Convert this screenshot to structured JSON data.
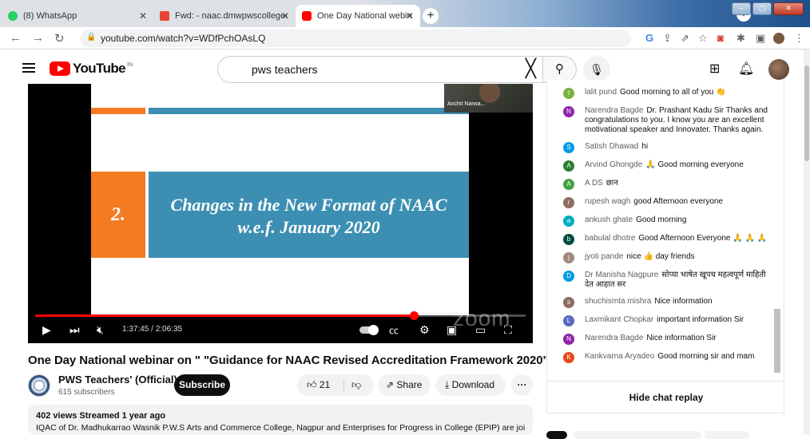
{
  "browser": {
    "tabs": [
      {
        "label": "(8) WhatsApp",
        "color": "#25d366"
      },
      {
        "label": "Fwd: - naac.dmwpwscollege@gm",
        "color": "#ea4335"
      },
      {
        "label": "One Day National webinar on \" \"",
        "color": "#ff0000"
      }
    ],
    "url": "youtube.com/watch?v=WDfPchOAsLQ"
  },
  "youtube": {
    "logo": "YouTube",
    "country": "IN",
    "search_query": "pws teachers"
  },
  "video": {
    "slide_number": "2.",
    "slide_line1": "Changes in the New Format of NAAC",
    "slide_line2": "w.e.f. January 2020",
    "participant_name": "Anchit Narwa...",
    "watermark": "zoom",
    "time": "1:37:45 / 2:06:35",
    "progress_fraction": 0.772
  },
  "meta": {
    "title": "One Day National webinar on \" \"Guidance for NAAC Revised Accreditation Framework 2020\"",
    "channel": "PWS Teachers' (Official)",
    "subscribers": "615 subscribers",
    "subscribe_label": "Subscribe",
    "likes": "21",
    "share_label": "Share",
    "download_label": "Download",
    "views": "402 views  Streamed 1 year ago",
    "description": "IQAC of Dr. Madhukarrao Wasnik P.W.S Arts and Commerce College, Nagpur and Enterprises for Progress in College (EPIP) are jointly"
  },
  "chat": {
    "messages": [
      {
        "initial": "l",
        "color": "#7cb342",
        "author": "lalit pund",
        "text": "Good morning to all of you 👏"
      },
      {
        "initial": "N",
        "color": "#8e24aa",
        "author": "Narendra Bagde",
        "text": "Dr. Prashant Kadu Sir Thanks and congratulations to you. I know you are an excellent motivational speaker and Innovater. Thanks again."
      },
      {
        "initial": "S",
        "color": "#039be5",
        "author": "Satish Dhawad",
        "text": "hi"
      },
      {
        "initial": "A",
        "color": "#2e7d32",
        "author": "Arvind Ghongde",
        "text": "🙏 Good morning everyone"
      },
      {
        "initial": "A",
        "color": "#43a047",
        "author": "A DS",
        "text": "छान"
      },
      {
        "initial": "r",
        "color": "#8d6e63",
        "author": "rupesh wagh",
        "text": "good Afternoon everyone"
      },
      {
        "initial": "a",
        "color": "#00acc1",
        "author": "ankush ghate",
        "text": "Good morning"
      },
      {
        "initial": "b",
        "color": "#004d40",
        "author": "babulal dhotre",
        "text": "Good Afternoon Everyone 🙏 🙏 🙏"
      },
      {
        "initial": "j",
        "color": "#a1887f",
        "author": "jyoti pande",
        "text": "nice 👍 day friends"
      },
      {
        "initial": "D",
        "color": "#039be5",
        "author": "Dr Manisha Nagpure",
        "text": "सोप्या भाषेत खूपच महत्वपूर्ण माहिती देत आहात सर"
      },
      {
        "initial": "s",
        "color": "#8d6e63",
        "author": "shuchismta mishra",
        "text": "Nice information"
      },
      {
        "initial": "L",
        "color": "#5c6bc0",
        "author": "Laxmikant Chopkar",
        "text": "important information Sir"
      },
      {
        "initial": "N",
        "color": "#8e24aa",
        "author": "Narendra Bagde",
        "text": "Nice information Sir"
      },
      {
        "initial": "K",
        "color": "#e64a19",
        "author": "Kankvarna Aryadeo",
        "text": "Good morning sir and mam"
      }
    ],
    "hide_label": "Hide chat replay"
  }
}
